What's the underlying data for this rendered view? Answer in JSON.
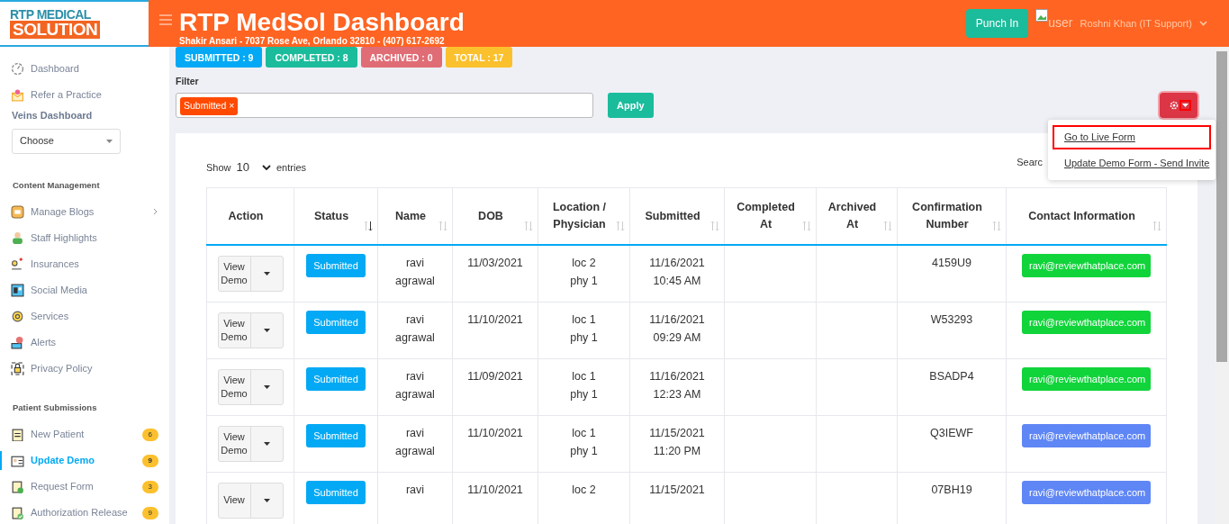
{
  "logo": {
    "line1": "RTP MEDICAL",
    "line2": "SOLUTION"
  },
  "header": {
    "title": "RTP MedSol Dashboard",
    "subtitle": "Shakir Ansari - 7037 Rose Ave, Orlando 32810 - (407) 617-2692",
    "punch_button": "Punch In",
    "avatar_alt": "user",
    "user_name": "Roshni Khan (IT Support)"
  },
  "sidebar": {
    "top_items": [
      {
        "label": "Dashboard",
        "selected": false
      },
      {
        "label": "Refer a Practice",
        "selected": false
      }
    ],
    "veins_heading": "Veins Dashboard",
    "veins_select": "Choose",
    "sections": [
      {
        "heading": "Content Management",
        "items": [
          {
            "label": "Manage Blogs",
            "selected": false,
            "expandable": true
          },
          {
            "label": "Staff Highlights",
            "selected": false,
            "expandable": false
          },
          {
            "label": "Insurances",
            "selected": false,
            "expandable": false
          },
          {
            "label": "Social Media",
            "selected": false,
            "expandable": false
          },
          {
            "label": "Services",
            "selected": false,
            "expandable": false
          },
          {
            "label": "Alerts",
            "selected": false,
            "expandable": false
          },
          {
            "label": "Privacy Policy",
            "selected": false,
            "expandable": false
          }
        ]
      },
      {
        "heading": "Patient Submissions",
        "items": [
          {
            "label": "New Patient",
            "selected": false,
            "badge": "6"
          },
          {
            "label": "Update Demo",
            "selected": true,
            "badge": "9"
          },
          {
            "label": "Request Form",
            "selected": false,
            "badge": "3"
          },
          {
            "label": "Authorization Release",
            "selected": false,
            "badge": "9"
          }
        ]
      }
    ]
  },
  "counters": [
    {
      "label": "SUBMITTED : 9",
      "color": "#03a9f4"
    },
    {
      "label": "COMPLETED : 8",
      "color": "#1abc9c"
    },
    {
      "label": "ARCHIVED : 0",
      "color": "#e06c75"
    },
    {
      "label": "TOTAL : 17",
      "color": "#fbc02d"
    }
  ],
  "filter": {
    "label": "Filter",
    "tags": [
      {
        "label": "Submitted",
        "remove": "×"
      }
    ],
    "apply_button": "Apply"
  },
  "settings_menu": {
    "expanded": true,
    "items": [
      {
        "label": "Go to Live Form",
        "highlighted": true
      },
      {
        "label": "Update Demo Form - Send Invite",
        "highlighted": false
      }
    ]
  },
  "table": {
    "show_label": "Show",
    "page_size": "10",
    "entries_label": "entries",
    "search_label": "Searc",
    "columns": [
      {
        "label": "Action",
        "sortable": false
      },
      {
        "label": "Status",
        "sortable": true,
        "sorted": true
      },
      {
        "label": "Name",
        "sortable": true,
        "sorted": false
      },
      {
        "label": "DOB",
        "sortable": true,
        "sorted": false
      },
      {
        "label": "Location / Physician",
        "sortable": true,
        "sorted": false
      },
      {
        "label": "Submitted",
        "sortable": true,
        "sorted": false
      },
      {
        "label": "Completed At",
        "sortable": true,
        "sorted": false
      },
      {
        "label": "Archived At",
        "sortable": true,
        "sorted": false
      },
      {
        "label": "Confirmation Number",
        "sortable": true,
        "sorted": false
      },
      {
        "label": "Contact Information",
        "sortable": true,
        "sorted": false
      }
    ],
    "rows": [
      {
        "action": [
          "View",
          "Demo"
        ],
        "status": "Submitted",
        "name": [
          "ravi",
          "agrawal"
        ],
        "dob": "11/03/2021",
        "location": [
          "loc 2",
          "phy 1"
        ],
        "submitted": [
          "11/16/2021",
          "10:45 AM"
        ],
        "confirmation": "4159U9",
        "contact": "ravi@reviewthatplace.com",
        "color": "#11d43b"
      },
      {
        "action": [
          "View",
          "Demo"
        ],
        "status": "Submitted",
        "name": [
          "ravi",
          "agrawal"
        ],
        "dob": "11/10/2021",
        "location": [
          "loc 1",
          "phy 1"
        ],
        "submitted": [
          "11/16/2021",
          "09:29 AM"
        ],
        "confirmation": "W53293",
        "contact": "ravi@reviewthatplace.com",
        "color": "#11d43b"
      },
      {
        "action": [
          "View",
          "Demo"
        ],
        "status": "Submitted",
        "name": [
          "ravi",
          "agrawal"
        ],
        "dob": "11/09/2021",
        "location": [
          "loc 1",
          "phy 1"
        ],
        "submitted": [
          "11/16/2021",
          "12:23 AM"
        ],
        "confirmation": "BSADP4",
        "contact": "ravi@reviewthatplace.com",
        "color": "#11d43b"
      },
      {
        "action": [
          "View",
          "Demo"
        ],
        "status": "Submitted",
        "name": [
          "ravi",
          "agrawal"
        ],
        "dob": "11/10/2021",
        "location": [
          "loc 1",
          "phy 1"
        ],
        "submitted": [
          "11/15/2021",
          "11:20 PM"
        ],
        "confirmation": "Q3IEWF",
        "contact": "ravi@reviewthatplace.com",
        "color": "#5f86f5"
      },
      {
        "action": [
          "View"
        ],
        "status": "Submitted",
        "name": [
          "ravi"
        ],
        "dob": "11/10/2021",
        "location": [
          "loc 2"
        ],
        "submitted": [
          "11/15/2021"
        ],
        "confirmation": "07BH19",
        "contact": "ravi@reviewthatplace.com",
        "color": "#5f86f5"
      }
    ]
  }
}
